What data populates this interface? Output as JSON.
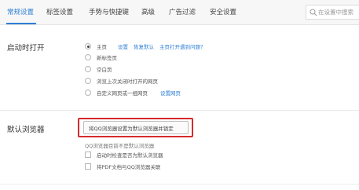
{
  "tabs": [
    {
      "label": "常规设置",
      "active": true
    },
    {
      "label": "标签设置"
    },
    {
      "label": "手势与快捷键"
    },
    {
      "label": "高级"
    },
    {
      "label": "广告过滤"
    },
    {
      "label": "安全设置"
    }
  ],
  "search": {
    "placeholder": "在设置中搜索"
  },
  "startup": {
    "label": "启动时打开",
    "options": [
      {
        "label": "主页",
        "checked": true
      },
      {
        "label": "新标签页"
      },
      {
        "label": "空白页"
      },
      {
        "label": "浏览上次关闭时打开的网页"
      },
      {
        "label": "自定义网页或一组网页"
      }
    ],
    "homepage_links": [
      "设置",
      "恢复默认",
      "主页打开遇到问题？"
    ],
    "custom_link": "设置网页"
  },
  "default_browser": {
    "label": "默认浏览器",
    "button_label": "将QQ浏览器设置为默认浏览器并锁定",
    "status": "QQ浏览器目前不是默认浏览器",
    "checkboxes": [
      {
        "label": "启动时检查是否为默认浏览器"
      },
      {
        "label": "将PDF文档与QQ浏览器关联"
      }
    ]
  },
  "colors": {
    "accent": "#2e7fd6",
    "highlight": "#d62b2b"
  }
}
